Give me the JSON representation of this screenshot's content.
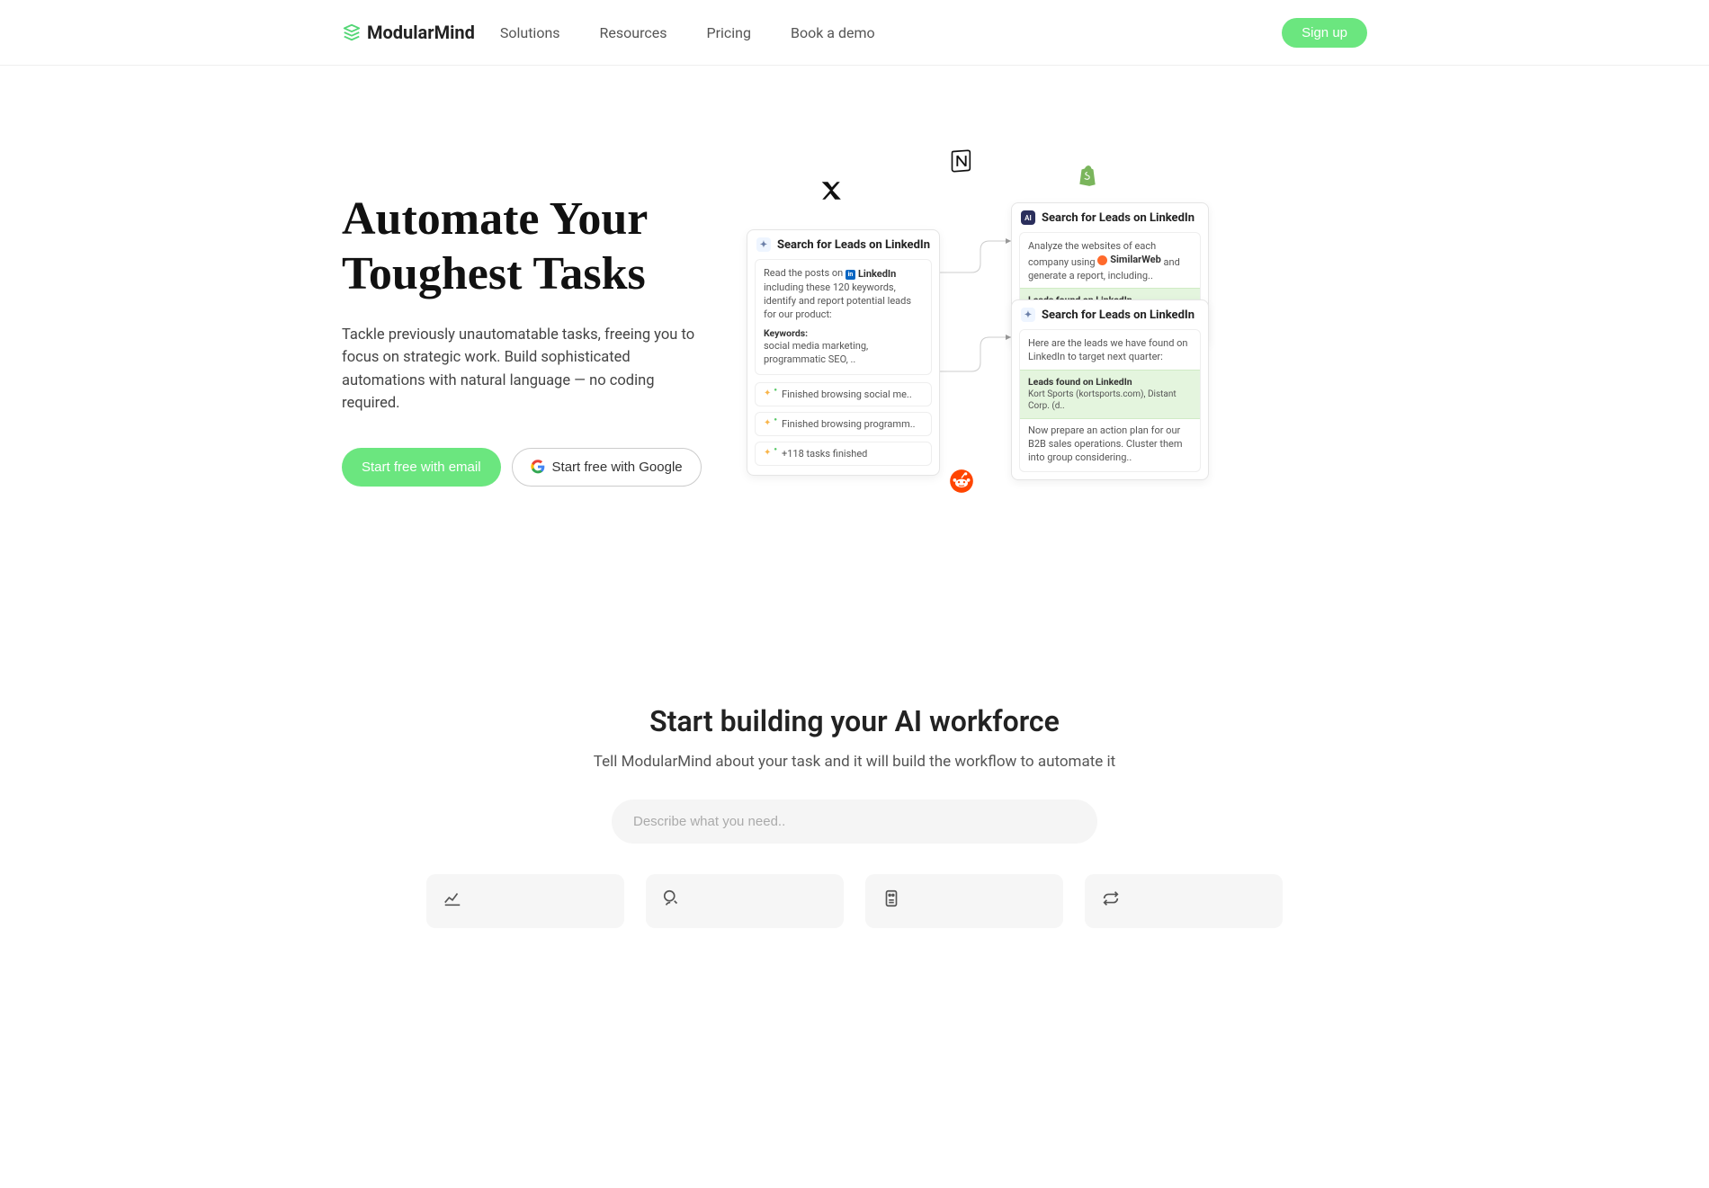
{
  "brand": "ModularMind",
  "nav": {
    "links": [
      "Solutions",
      "Resources",
      "Pricing",
      "Book a demo"
    ],
    "signup": "Sign up"
  },
  "hero": {
    "title_l1": "Automate Your",
    "title_l2": "Toughest Tasks",
    "subtitle": "Tackle previously unautomatable tasks, freeing you to focus on strategic work. Build sophisticated automations with natural language — no coding required.",
    "cta_primary": "Start free with email",
    "cta_secondary": "Start free with Google"
  },
  "cards": {
    "c1": {
      "title": "Search for Leads on LinkedIn",
      "body_pre": "Read the posts on ",
      "body_chip": "LinkedIn",
      "body_post": " including these 120 keywords, identify and report potential leads for our product:",
      "kw_label": "Keywords:",
      "kw_text": "social media marketing, programmatic SEO, ..",
      "pills": [
        "Finished browsing social me..",
        "Finished browsing programm..",
        "+118 tasks finished"
      ]
    },
    "c2": {
      "title": "Search for Leads on LinkedIn",
      "body_pre": "Analyze the websites of each company using ",
      "body_chip": "SimilarWeb",
      "body_post": " and generate a report, including..",
      "leads_title": "Leads found on LinkedIn",
      "leads_sub": "Kort Sports (kortsports.com), Distant Corp. (d.."
    },
    "c3": {
      "title": "Search for Leads on LinkedIn",
      "body": "Here are the leads we have found on LinkedIn to target next quarter:",
      "leads_title": "Leads found on LinkedIn",
      "leads_sub": "Kort Sports (kortsports.com), Distant Corp. (d..",
      "tail": "Now prepare an action plan for our B2B sales operations. Cluster them into group considering.."
    }
  },
  "section2": {
    "title": "Start building your AI workforce",
    "subtitle": "Tell ModularMind about your task and it will build the workflow to automate it",
    "placeholder": "Describe what you need.."
  }
}
